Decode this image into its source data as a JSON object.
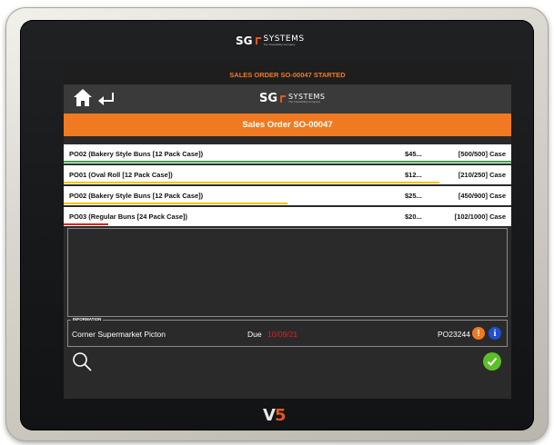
{
  "device": {
    "bezel_logo": {
      "sg": "SG",
      "systems": "SYSTEMS",
      "tagline": "The Traceability Company"
    },
    "model_logo": {
      "v": "V",
      "number": "5"
    }
  },
  "status_bar": {
    "text": "SALES ORDER SO-00047 STARTED"
  },
  "nav": {
    "home_icon": "home-icon",
    "back_icon": "back-arrow-icon",
    "logo": {
      "sg": "SG",
      "systems": "SYSTEMS",
      "tagline": "The Traceability Company"
    }
  },
  "title_bar": {
    "text": "Sales Order SO-00047"
  },
  "order_lines": [
    {
      "name": "PO02 (Bakery Style Buns [12 Pack Case])",
      "price": "$45...",
      "quantity": "[500/500] Case",
      "progress": 1.0,
      "progress_color": "#3aa84a"
    },
    {
      "name": "PO01 (Oval Roll [12 Pack Case])",
      "price": "$12...",
      "quantity": "[210/250] Case",
      "progress": 0.84,
      "progress_color": "#f2c400"
    },
    {
      "name": "PO02 (Bakery Style Buns [12 Pack Case])",
      "price": "$25...",
      "quantity": "[450/900] Case",
      "progress": 0.5,
      "progress_color": "#f2c400"
    },
    {
      "name": "PO03 (Regular Buns [24 Pack Case])",
      "price": "$20...",
      "quantity": "[102/1000] Case",
      "progress": 0.1,
      "progress_color": "#d9261c"
    }
  ],
  "information": {
    "title": "INFORMATION",
    "customer": "Corner Supermarket Picton",
    "due_label": "Due",
    "due_date": "10/09/21",
    "po_number": "PO23244",
    "warning_icon": "exclamation-icon",
    "info_icon": "info-icon",
    "warning_glyph": "!",
    "info_glyph": "i"
  },
  "footer": {
    "search_icon": "search-icon",
    "confirm_icon": "checkmark-icon"
  },
  "colors": {
    "accent": "#f07a21",
    "due_date": "#e0211c",
    "confirm": "#5bbf2a",
    "info": "#1f4fd0"
  }
}
